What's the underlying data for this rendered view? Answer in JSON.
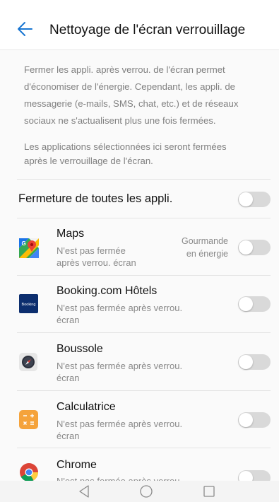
{
  "header": {
    "title": "Nettoyage de l'écran verrouillage"
  },
  "description": {
    "line1": "Fermer les appli. après verrou. de l'écran permet",
    "line2": "d'économiser de l'énergie. Cependant, les appli. de",
    "line3": "messagerie (e-mails, SMS, chat, etc.) et de réseaux",
    "line4": "sociaux ne s'actualisent plus une fois fermées.",
    "note1": "Les applications sélectionnées ici seront fermées",
    "note2": "après le verrouillage de l'écran."
  },
  "all_apps": {
    "label": "Fermeture de toutes les appli.",
    "enabled": false
  },
  "apps": [
    {
      "name": "Maps",
      "status_line1": "N'est pas fermée",
      "status_line2": "après verrou. écran",
      "badge_line1": "Gourmande",
      "badge_line2": "en énergie",
      "icon": "google-maps-icon",
      "enabled": false
    },
    {
      "name": "Booking.com Hôtels",
      "status_line1": "N'est pas fermée après verrou.",
      "status_line2": "écran",
      "icon": "booking-icon",
      "icon_text": "Booking",
      "enabled": false
    },
    {
      "name": "Boussole",
      "status_line1": "N'est pas fermée après verrou.",
      "status_line2": "écran",
      "icon": "compass-icon",
      "enabled": false
    },
    {
      "name": "Calculatrice",
      "status_line1": "N'est pas fermée après verrou.",
      "status_line2": "écran",
      "icon": "calculator-icon",
      "enabled": false
    },
    {
      "name": "Chrome",
      "status_line1": "N'est pas fermée après verrou.",
      "icon": "chrome-icon",
      "enabled": false
    }
  ],
  "navbar": {
    "back": "back-triangle-icon",
    "home": "home-circle-icon",
    "recents": "recents-square-icon"
  },
  "colors": {
    "accent": "#1976d2",
    "toggle_off": "#d9d9d9",
    "secondary_text": "#808080"
  }
}
